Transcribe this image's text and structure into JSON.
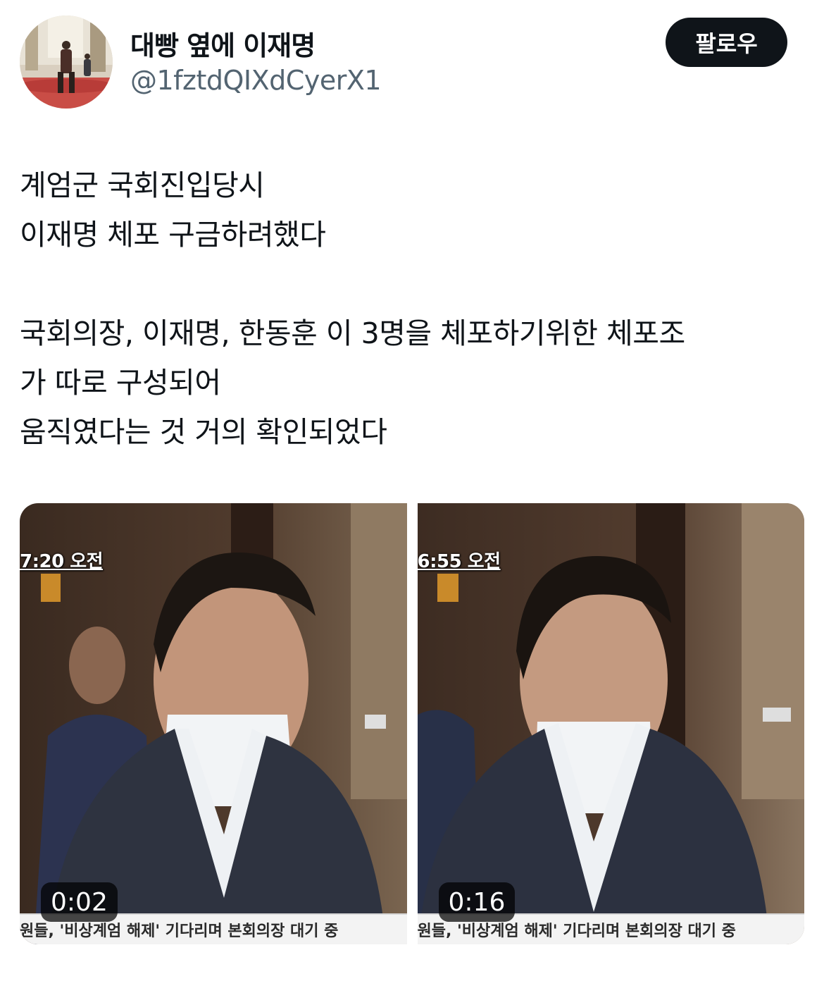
{
  "user": {
    "display_name": "대빵 옆에 이재명",
    "handle": "@1fztdQIXdCyerX1"
  },
  "follow_button_label": "팔로우",
  "tweet": {
    "paragraph1": [
      "계엄군 국회진입당시",
      "이재명 체포 구금하려했다"
    ],
    "paragraph2": [
      "국회의장, 이재명, 한동훈 이 3명을 체포하기위한 체포조",
      "가 따로 구성되어",
      "움직였다는 것 거의 확인되었다"
    ]
  },
  "videos": [
    {
      "timestamp_overlay": "7:20 오전",
      "ticker_text": "원들, '비상계엄 해제' 기다리며 본회의장 대기 중",
      "duration": "0:02"
    },
    {
      "timestamp_overlay": "6:55 오전",
      "ticker_text": "원들, '비상계엄 해제' 기다리며 본회의장 대기 중",
      "duration": "0:16"
    }
  ],
  "colors": {
    "follow_button_bg": "#0f1419",
    "handle_text": "#536471"
  }
}
